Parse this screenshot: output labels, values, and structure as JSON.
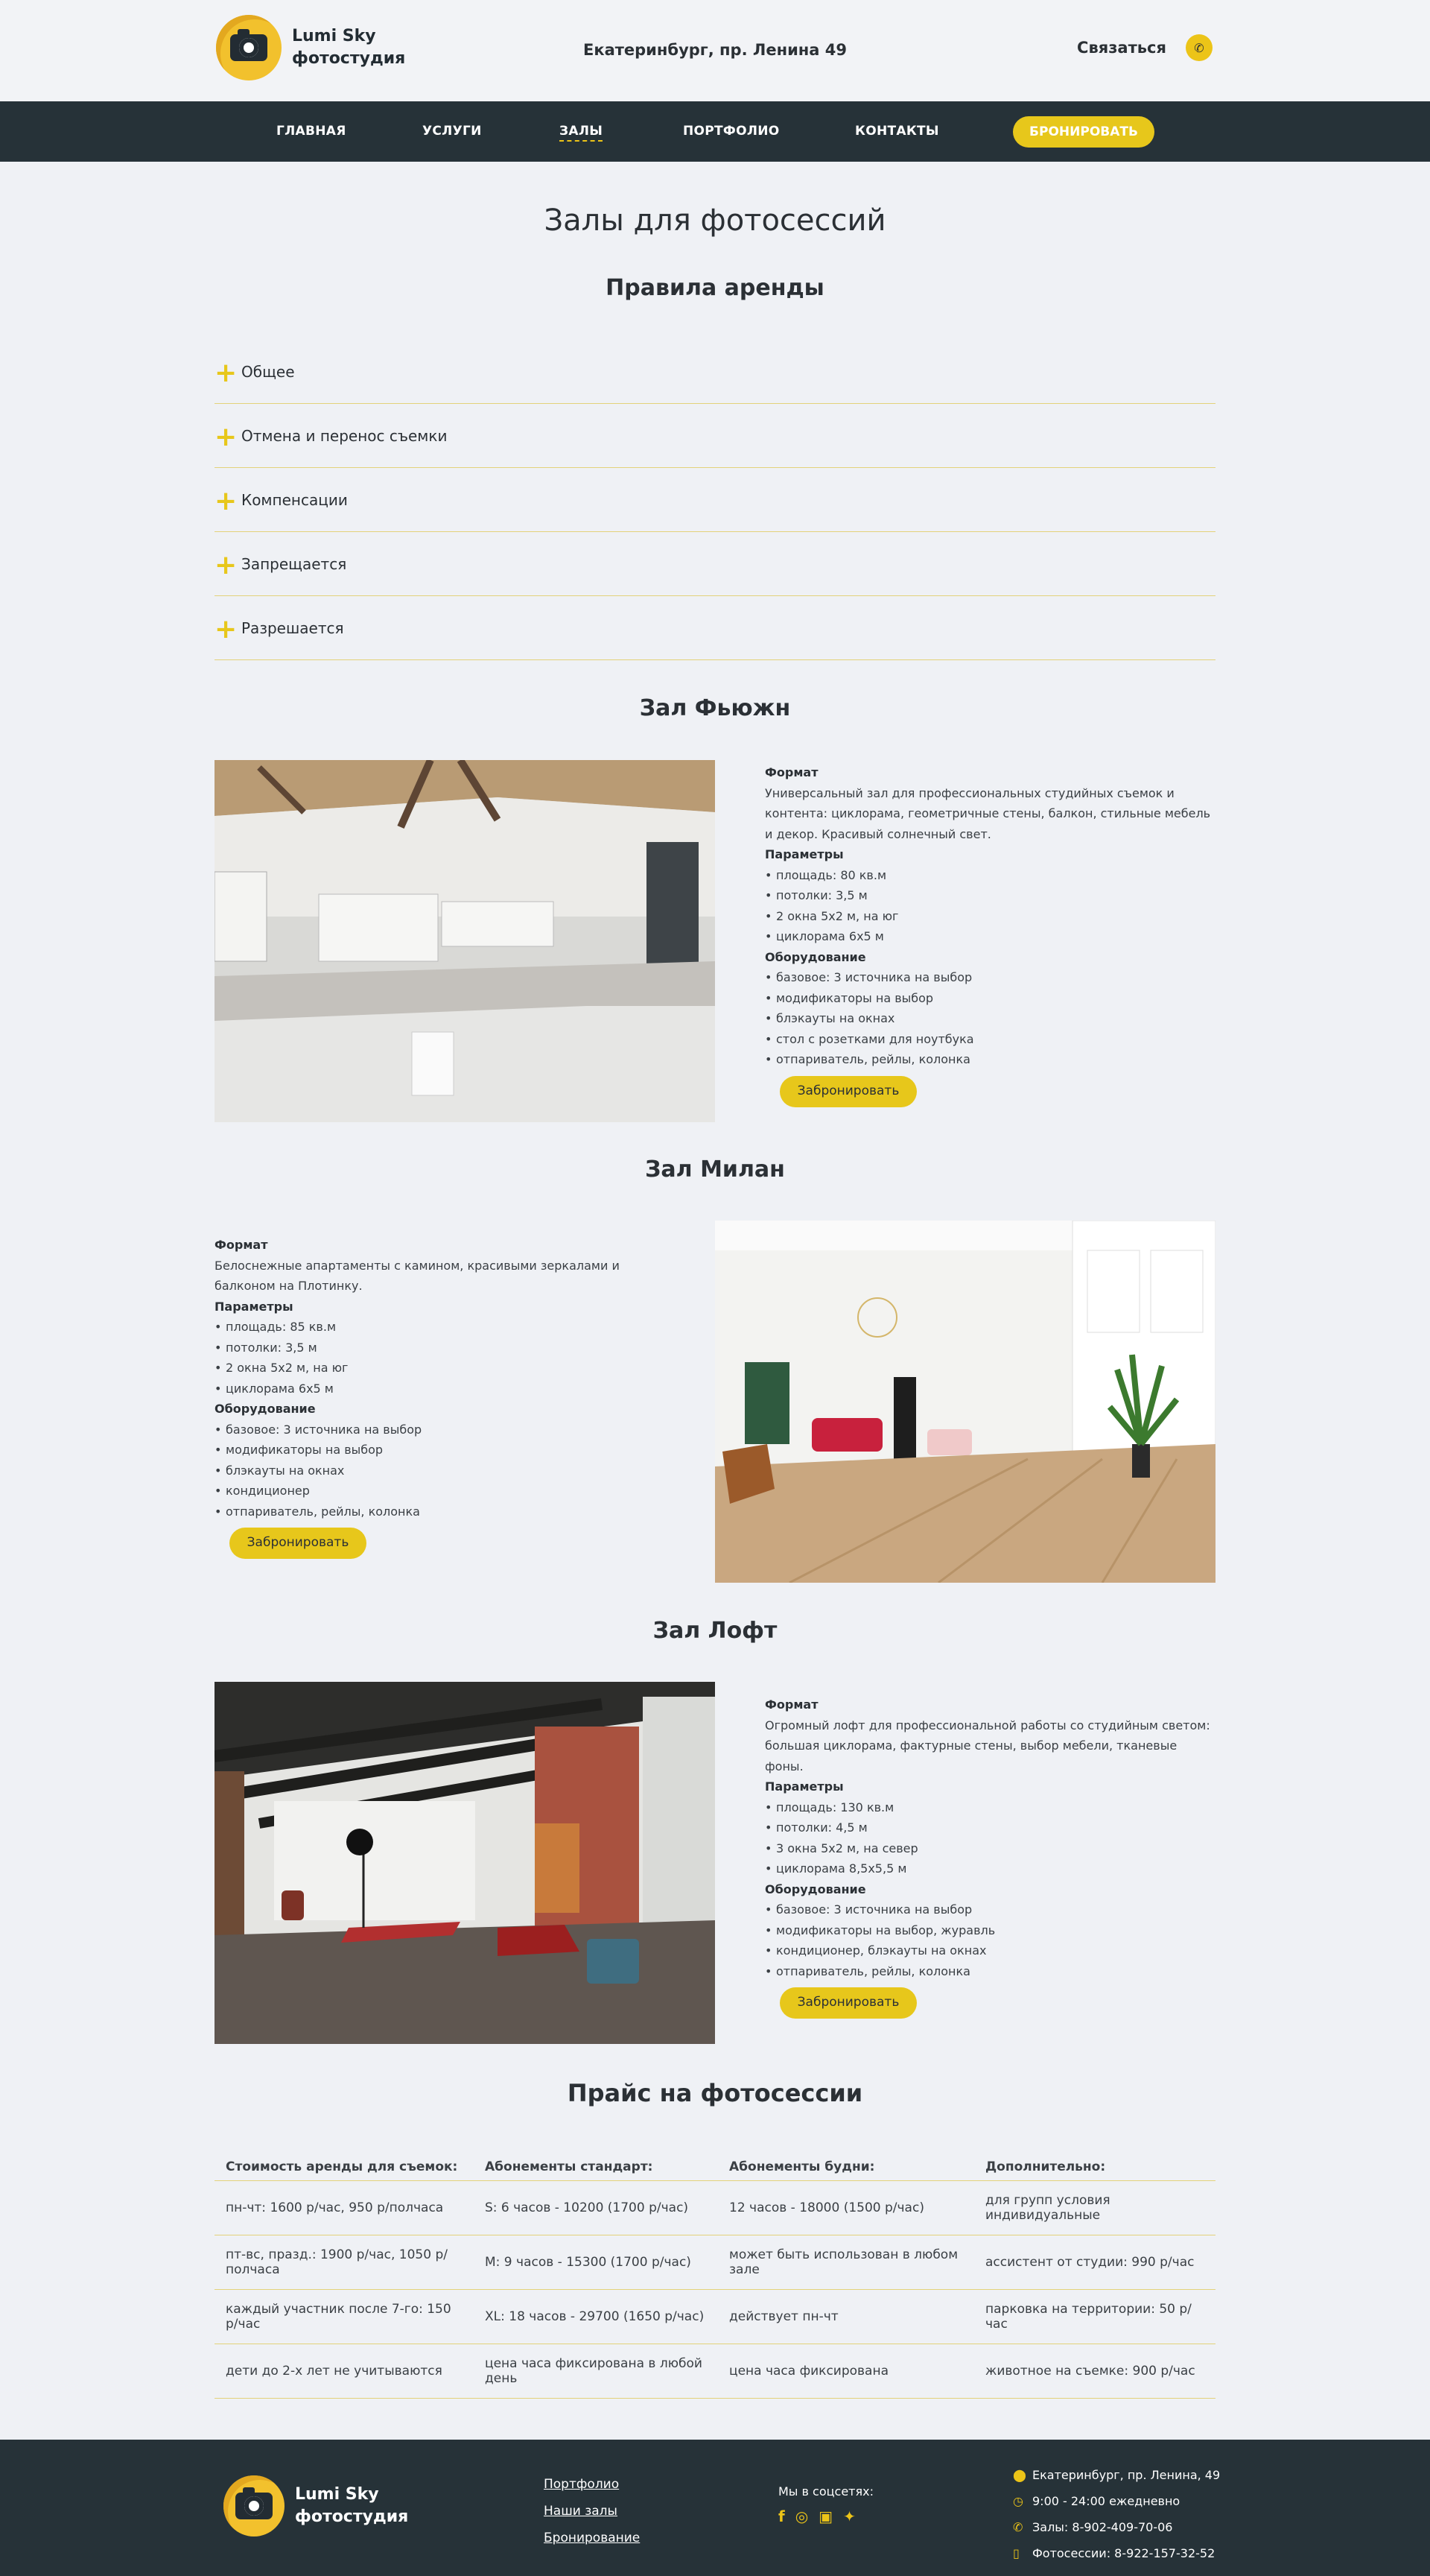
{
  "header": {
    "brand_line1": "Lumi Sky",
    "brand_line2": "фотостудия",
    "address": "Екатеринбург, пр. Ленина 49",
    "contact_label": "Связаться"
  },
  "nav": {
    "items": [
      "ГЛАВНАЯ",
      "УСЛУГИ",
      "ЗАЛЫ",
      "ПОРТФОЛИО",
      "КОНТАКТЫ"
    ],
    "active": "ЗАЛЫ",
    "cta": "БРОНИРОВАТЬ"
  },
  "page": {
    "title": "Залы для фотосессий",
    "rules_title": "Правила аренды",
    "rules": [
      "Общее",
      "Отмена и перенос съемки",
      "Компенсации",
      "Запрещается",
      "Разрешается"
    ]
  },
  "labels": {
    "format": "Формат",
    "params": "Параметры",
    "equipment": "Оборудование",
    "book": "Забронировать"
  },
  "halls": [
    {
      "title": "Зал Фьюжн",
      "format": "Универсальный зал для профессиональных студийных съемок и контента: циклорама, геометричные стены, балкон, стильные мебель и декор. Красивый солнечный свет.",
      "params": [
        "площадь: 80 кв.м",
        "потолки: 3,5 м",
        "2 окна 5х2 м, на юг",
        "циклорама 6х5 м"
      ],
      "equipment": [
        "базовое: 3 источника на выбор",
        "модификаторы на выбор",
        "блэкауты на окнах",
        "стол с розетками для ноутбука",
        "отпариватель, рейлы, колонка"
      ]
    },
    {
      "title": "Зал Милан",
      "format": "Белоснежные апартаменты с камином, красивыми зеркалами и балконом на Плотинку.",
      "params": [
        "площадь: 85 кв.м",
        "потолки: 3,5 м",
        "2 окна 5х2 м, на юг",
        "циклорама 6х5 м"
      ],
      "equipment": [
        "базовое: 3 источника на выбор",
        "модификаторы на выбор",
        "блэкауты на окнах",
        "кондиционер",
        "отпариватель, рейлы, колонка"
      ]
    },
    {
      "title": "Зал Лофт",
      "format": "Огромный лофт для профессиональной работы со студийным светом: большая циклорама, фактурные стены, выбор мебели, тканевые фоны.",
      "params": [
        "площадь: 130 кв.м",
        "потолки: 4,5 м",
        "3 окна 5х2 м, на север",
        "циклорама 8,5х5,5 м"
      ],
      "equipment": [
        "базовое: 3 источника на выбор",
        "модификаторы на выбор, журавль",
        "кондиционер, блэкауты на окнах",
        "отпариватель, рейлы, колонка"
      ]
    }
  ],
  "price": {
    "title": "Прайс на фотосессии",
    "headers": [
      "Стоимость аренды для съемок:",
      "Абонементы стандарт:",
      "Абонементы будни:",
      "Дополнительно:"
    ],
    "rows": [
      [
        "пн-чт: 1600 р/час, 950 р/полчаса",
        "S: 6 часов - 10200 (1700 р/час)",
        "12 часов - 18000 (1500 р/час)",
        "для групп условия индивидуальные"
      ],
      [
        "пт-вс, празд.: 1900 р/час, 1050 р/полчаса",
        "M: 9 часов - 15300 (1700 р/час)",
        "может быть использован в любом зале",
        "ассистент от студии: 990 р/час"
      ],
      [
        "каждый участник после 7-го: 150 р/час",
        "XL: 18 часов - 29700 (1650 р/час)",
        "действует пн-чт",
        "парковка на территории: 50 р/час"
      ],
      [
        "дети до 2-х лет не учитываются",
        "цена часа фиксирована в любой день",
        "цена часа фиксирована",
        "животное на съемке: 900 р/час"
      ]
    ]
  },
  "footer": {
    "links": [
      "Портфолио",
      "Наши залы",
      "Бронирование"
    ],
    "social_label": "Мы в соцсетях:",
    "address": "Екатеринбург, пр. Ленина, 49",
    "hours": "9:00 - 24:00 ежедневно",
    "phone_halls": "Залы: 8-902-409-70-06",
    "phone_sessions": "Фотосессии: 8-922-157-32-52"
  }
}
